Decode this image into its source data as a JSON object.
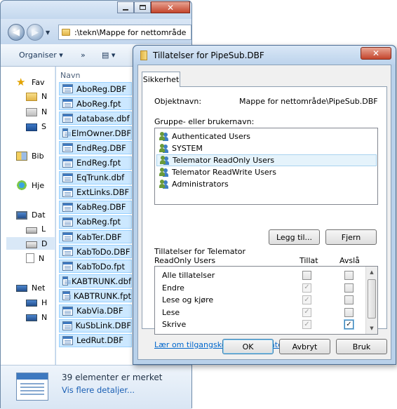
{
  "explorer": {
    "address": ":\\tekn\\Mappe for nettområde",
    "toolbar": {
      "organize": "Organiser ▾",
      "more": "»",
      "view": "▤ ▾"
    },
    "column_header": "Navn",
    "nav": [
      {
        "label": "Fav",
        "icon": "star-icon"
      },
      {
        "label": "N",
        "icon": "folder-icon"
      },
      {
        "label": "N",
        "icon": "folder-icon"
      },
      {
        "label": "S",
        "icon": "desktop-icon"
      },
      {
        "label": "Bib",
        "icon": "library-icon"
      },
      {
        "label": "Hje",
        "icon": "homegroup-icon"
      },
      {
        "label": "Dat",
        "icon": "computer-icon"
      },
      {
        "label": "L",
        "icon": "drive-icon"
      },
      {
        "label": "D",
        "icon": "drive-icon"
      },
      {
        "label": "N",
        "icon": "document-icon"
      },
      {
        "label": "Net",
        "icon": "network-icon"
      },
      {
        "label": "H",
        "icon": "pc-icon"
      },
      {
        "label": "N",
        "icon": "pc-icon"
      }
    ],
    "files": [
      "AboReg.DBF",
      "AboReg.fpt",
      "database.dbf",
      "ElmOwner.DBF",
      "EndReg.DBF",
      "EndReg.fpt",
      "EqTrunk.dbf",
      "ExtLinks.DBF",
      "KabReg.DBF",
      "KabReg.fpt",
      "KabTer.DBF",
      "KabToDo.DBF",
      "KabToDo.fpt",
      "KABTRUNK.dbf",
      "KABTRUNK.fpt",
      "KabVia.DBF",
      "KuSbLink.DBF",
      "LedRut.DBF"
    ],
    "status_count": "39 elementer er merket",
    "status_details": "Vis flere detaljer..."
  },
  "dialog": {
    "title": "Tillatelser for PipeSub.DBF",
    "close_glyph": "✕",
    "tab": "Sikkerhet",
    "object_label": "Objektnavn:",
    "object_value": "Mappe for nettområde\\PipeSub.DBF",
    "group_label": "Gruppe- eller brukernavn:",
    "users": [
      "Authenticated Users",
      "SYSTEM",
      "Telemator ReadOnly Users",
      "Telemator ReadWrite Users",
      "Administrators"
    ],
    "selected_user_index": 2,
    "add_button": "Legg til...",
    "remove_button": "Fjern",
    "perm_label_1": "Tillatelser for Telemator",
    "perm_label_2": "ReadOnly Users",
    "allow_header": "Tillat",
    "deny_header": "Avslå",
    "permissions": [
      {
        "name": "Alle tillatelser",
        "allow": false,
        "allow_disabled": false,
        "deny": false
      },
      {
        "name": "Endre",
        "allow": true,
        "allow_disabled": true,
        "deny": false
      },
      {
        "name": "Lese og kjøre",
        "allow": true,
        "allow_disabled": true,
        "deny": false
      },
      {
        "name": "Lese",
        "allow": true,
        "allow_disabled": true,
        "deny": false
      },
      {
        "name": "Skrive",
        "allow": true,
        "allow_disabled": true,
        "deny": true
      }
    ],
    "link": "Lær om tilgangskontroll og tillatelser",
    "ok": "OK",
    "cancel": "Avbryt",
    "apply": "Bruk",
    "check_glyph": "✓"
  }
}
